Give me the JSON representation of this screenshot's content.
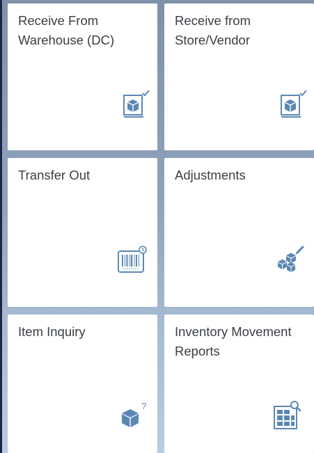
{
  "tiles": [
    {
      "label": "Receive From\nWarehouse (DC)",
      "icon": "receive-box-check-icon"
    },
    {
      "label": "Receive from\nStore/Vendor",
      "icon": "receive-box-check-icon"
    },
    {
      "label": "Transfer Out",
      "icon": "barcode-transfer-icon"
    },
    {
      "label": "Adjustments",
      "icon": "cubes-edit-icon"
    },
    {
      "label": "Item Inquiry",
      "icon": "box-question-icon"
    },
    {
      "label": "Inventory Movement\nReports",
      "icon": "report-search-icon"
    }
  ],
  "colors": {
    "icon": "#5b87b5",
    "text": "#3a3f44",
    "tile": "#ffffff"
  }
}
